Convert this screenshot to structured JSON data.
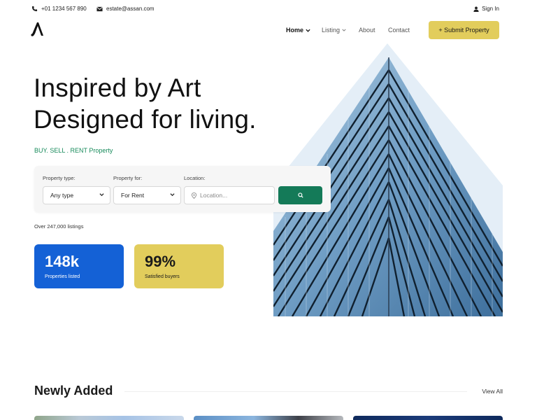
{
  "topbar": {
    "phone": "+01 1234 567 890",
    "email": "estate@assan.com",
    "signin": "Sign In"
  },
  "nav": {
    "items": [
      {
        "label": "Home",
        "active": true,
        "dropdown": true
      },
      {
        "label": "Listing",
        "active": false,
        "dropdown": true
      },
      {
        "label": "About",
        "active": false,
        "dropdown": false
      },
      {
        "label": "Contact",
        "active": false,
        "dropdown": false
      }
    ],
    "submit_label": "+ Submit Property"
  },
  "hero": {
    "title_line1": "Inspired by Art",
    "title_line2": "Designed for living.",
    "subtitle": "BUY. SELL . RENT Property"
  },
  "search": {
    "type_label": "Property type:",
    "type_value": "Any type",
    "for_label": "Property for:",
    "for_value": "For Rent",
    "location_label": "Location:",
    "location_placeholder": "Location..."
  },
  "listings_count": "Over 247,000 listings",
  "stats": [
    {
      "value": "148k",
      "label": "Properties listed"
    },
    {
      "value": "99%",
      "label": "Satisfied buyers"
    }
  ],
  "newly_added": {
    "title": "Newly Added",
    "view_all": "View All"
  },
  "colors": {
    "accent_yellow": "#e2cd5c",
    "accent_green": "#147a58",
    "accent_blue": "#1461d6",
    "subtitle_green": "#168a5a"
  },
  "icons": [
    "phone-icon",
    "mail-icon",
    "user-icon",
    "logo-icon",
    "chevron-down-icon",
    "location-pin-icon",
    "search-icon"
  ]
}
